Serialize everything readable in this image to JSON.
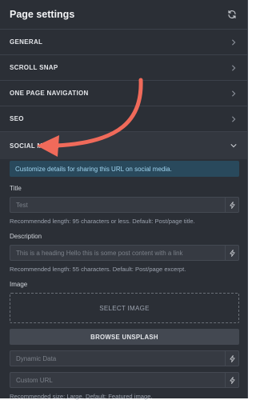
{
  "header": {
    "title": "Page settings",
    "refresh_icon": "refresh-icon"
  },
  "sections": [
    {
      "label": "GENERAL"
    },
    {
      "label": "SCROLL SNAP"
    },
    {
      "label": "ONE PAGE NAVIGATION"
    },
    {
      "label": "SEO"
    },
    {
      "label": "SOCIAL MEDIA",
      "expanded": true
    }
  ],
  "social": {
    "info": "Customize details for sharing this URL on social media.",
    "title_label": "Title",
    "title_placeholder": "Test",
    "title_hint": "Recommended length: 95 characters or less. Default: Post/page title.",
    "description_label": "Description",
    "description_placeholder": "This is a heading Hello this is some post content with a link",
    "description_hint": "Recommended length: 55 characters. Default: Post/page excerpt.",
    "image_label": "Image",
    "select_image": "SELECT IMAGE",
    "browse_unsplash": "BROWSE UNSPLASH",
    "dynamic_data_placeholder": "Dynamic Data",
    "custom_url_placeholder": "Custom URL",
    "image_hint": "Recommended size: Large. Default: Featured image."
  },
  "colors": {
    "accent_arrow": "#f06a5a",
    "panel_bg": "#2b2f36",
    "info_bg": "#29495c"
  }
}
